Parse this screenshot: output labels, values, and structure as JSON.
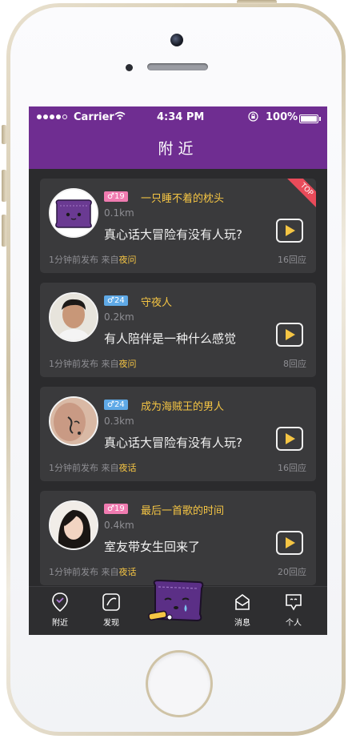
{
  "status_bar": {
    "carrier": "Carrier",
    "time": "4:34 PM",
    "battery": "100%"
  },
  "nav": {
    "title": "附近"
  },
  "posts": [
    {
      "gender": "♂19",
      "gender_color": "#f07bb0",
      "nickname": "一只睡不着的枕头",
      "distance": "0.1km",
      "title": "真心话大冒险有没有人玩?",
      "posted": "1分钟前发布 来自",
      "source": "夜问",
      "replies": "16回应",
      "badge": "TOP"
    },
    {
      "gender": "♂24",
      "gender_color": "#5fa9e6",
      "nickname": "守夜人",
      "distance": "0.2km",
      "title": "有人陪伴是一种什么感觉",
      "posted": "1分钟前发布 来自",
      "source": "夜问",
      "replies": "8回应"
    },
    {
      "gender": "♂24",
      "gender_color": "#5fa9e6",
      "nickname": "成为海贼王的男人",
      "distance": "0.3km",
      "title": "真心话大冒险有没有人玩?",
      "posted": "1分钟前发布 来自",
      "source": "夜话",
      "replies": "16回应"
    },
    {
      "gender": "♂19",
      "gender_color": "#f07bb0",
      "nickname": "最后一首歌的时间",
      "distance": "0.4km",
      "title": "室友带女生回来了",
      "posted": "1分钟前发布 来自",
      "source": "夜话",
      "replies": "20回应"
    }
  ],
  "tabs": [
    {
      "label": "附近",
      "icon": "location-icon"
    },
    {
      "label": "发现",
      "icon": "discover-icon"
    },
    {
      "label": "",
      "icon": "pillow-icon"
    },
    {
      "label": "消息",
      "icon": "message-icon"
    },
    {
      "label": "个人",
      "icon": "profile-icon"
    }
  ],
  "colors": {
    "brand_purple": "#6f2d91",
    "accent_yellow": "#f5c544",
    "card_bg": "#3a3a3c",
    "screen_bg": "#2b2b2d"
  }
}
